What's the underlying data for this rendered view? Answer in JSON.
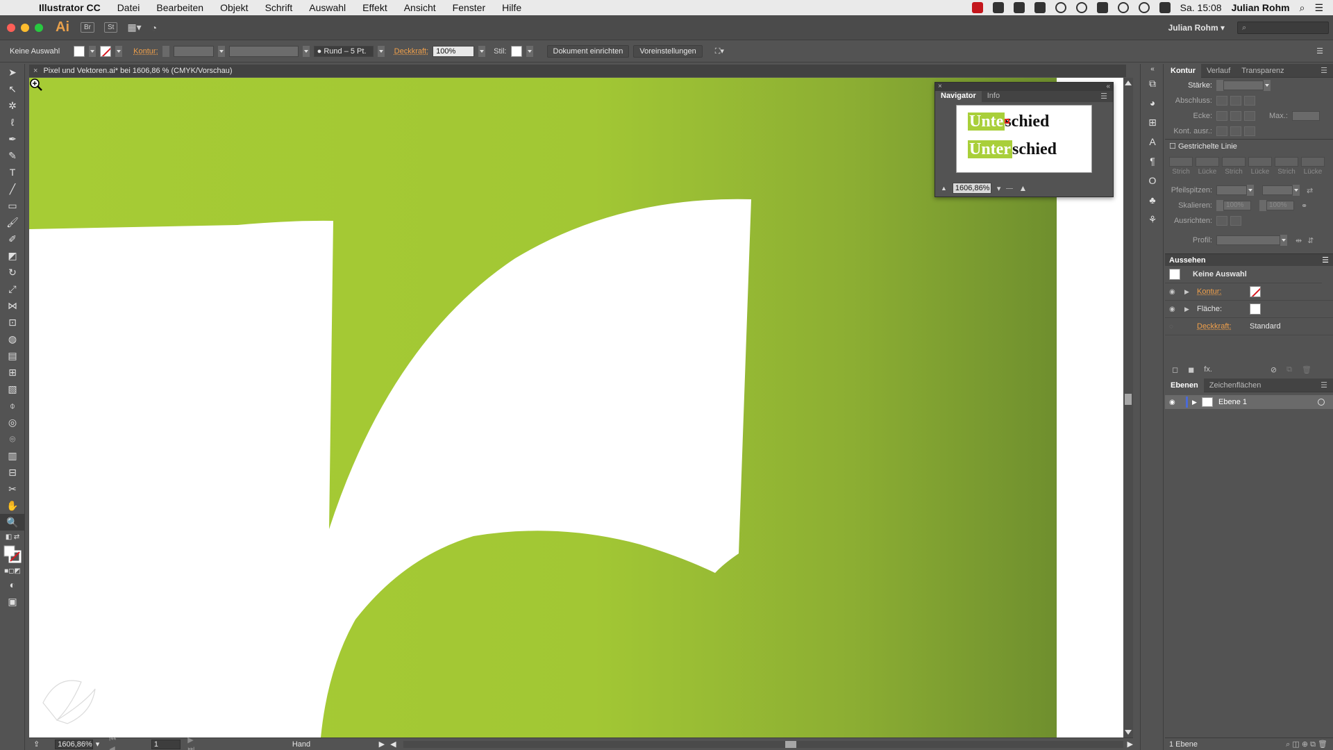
{
  "menubar": {
    "apple": "",
    "app_name": "Illustrator CC",
    "items": [
      "Datei",
      "Bearbeiten",
      "Objekt",
      "Schrift",
      "Auswahl",
      "Effekt",
      "Ansicht",
      "Fenster",
      "Hilfe"
    ],
    "clock": "Sa. 15:08",
    "user": "Julian Rohm"
  },
  "appbar": {
    "logo": "Ai",
    "bridge": "Br",
    "stock": "St",
    "workspace_user": "Julian Rohm",
    "search_placeholder": ""
  },
  "control_bar": {
    "selection_label": "Keine Auswahl",
    "kontur_label": "Kontur:",
    "brush_value": "Rund – 5 Pt.",
    "deckkraft_label": "Deckkraft:",
    "deckkraft_value": "100%",
    "stil_label": "Stil:",
    "dokument_btn": "Dokument einrichten",
    "voreinstellungen_btn": "Voreinstellungen"
  },
  "document": {
    "tab_title": "Pixel und Vektoren.ai* bei 1606,86 % (CMYK/Vorschau)",
    "canvas_green": "#a6cc35",
    "canvas_green_dark": "#6f8f2e"
  },
  "status_bar": {
    "zoom": "1606,86%",
    "page": "1",
    "tool": "Hand"
  },
  "navigator": {
    "tabs": [
      "Navigator",
      "Info"
    ],
    "word1_highlight": "Unte",
    "word1_rest": "schied",
    "word2_highlight": "Unter",
    "word2_rest": "schied",
    "zoom_value": "1606,86%"
  },
  "kontur_panel": {
    "tabs": [
      "Kontur",
      "Verlauf",
      "Transparenz"
    ],
    "staerke_label": "Stärke:",
    "abschluss_label": "Abschluss:",
    "ecke_label": "Ecke:",
    "max_label": "Max.:",
    "kont_ausr_label": "Kont. ausr.:",
    "gestrichelte_label": "Gestrichelte Linie",
    "dash_labels": [
      "Strich",
      "Lücke",
      "Strich",
      "Lücke",
      "Strich",
      "Lücke"
    ],
    "pfeilspitzen_label": "Pfeilspitzen:",
    "skalieren_label": "Skalieren:",
    "skalieren_value1": "100%",
    "skalieren_value2": "100%",
    "ausrichten_label": "Ausrichten:",
    "profil_label": "Profil:"
  },
  "aussehen_panel": {
    "title": "Aussehen",
    "selection": "Keine Auswahl",
    "kontur_label": "Kontur:",
    "flaeche_label": "Fläche:",
    "deckkraft_label": "Deckkraft:",
    "deckkraft_value": "Standard"
  },
  "ebenen_panel": {
    "tabs": [
      "Ebenen",
      "Zeichenflächen"
    ],
    "layer_name": "Ebene 1",
    "count": "1 Ebene"
  }
}
